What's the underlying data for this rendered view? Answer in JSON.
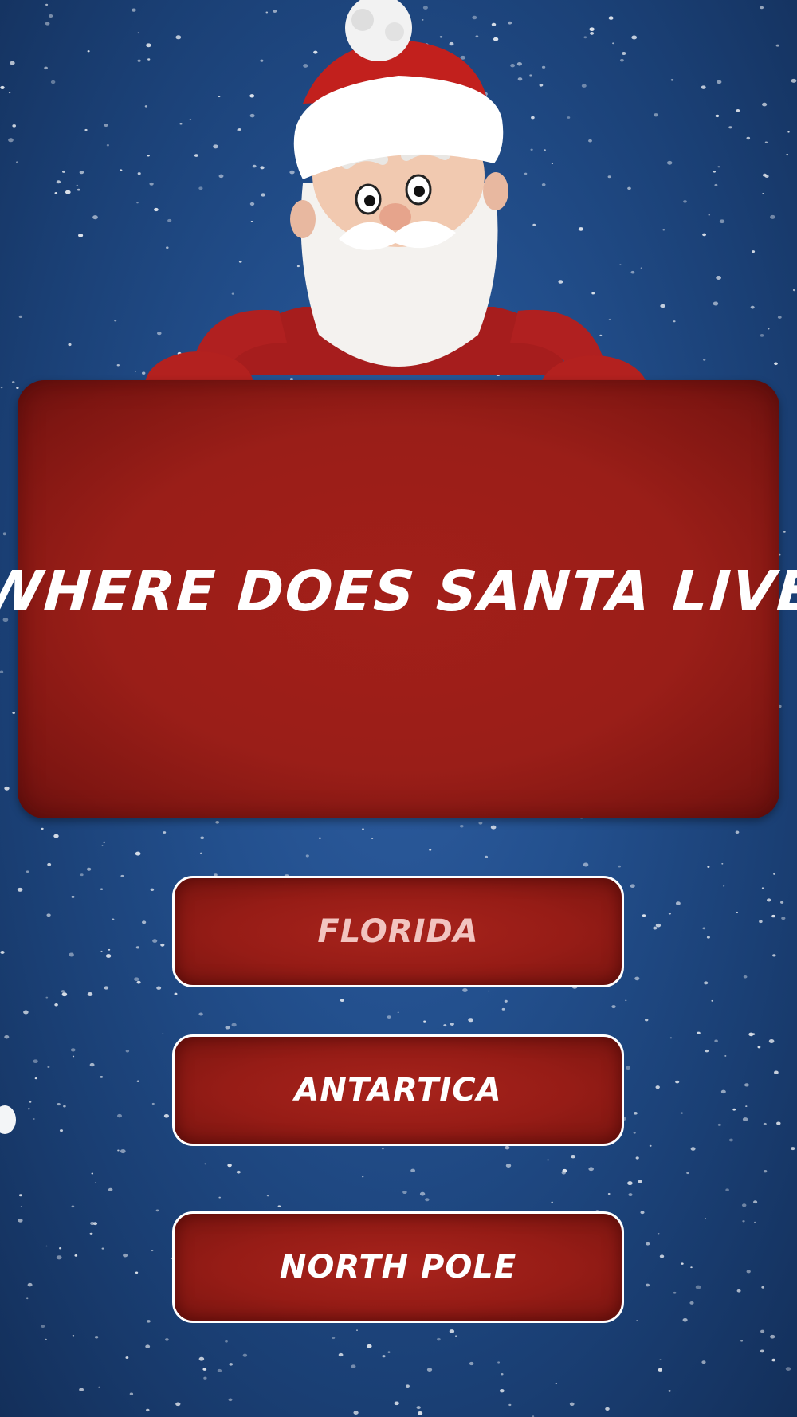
{
  "quiz": {
    "question": "WHERE DOES SANTA LIVE",
    "answers": [
      {
        "label": "FLORIDA"
      },
      {
        "label": "ANTARTICA"
      },
      {
        "label": "NORTH POLE"
      }
    ]
  },
  "colors": {
    "background": "#23508e",
    "sign_red": "#9a1e18",
    "button_border": "#ffffff",
    "text": "#ffffff",
    "faded_text": "#f2c4c0"
  },
  "icons": [
    "santa-character-icon",
    "snowflake-background"
  ]
}
